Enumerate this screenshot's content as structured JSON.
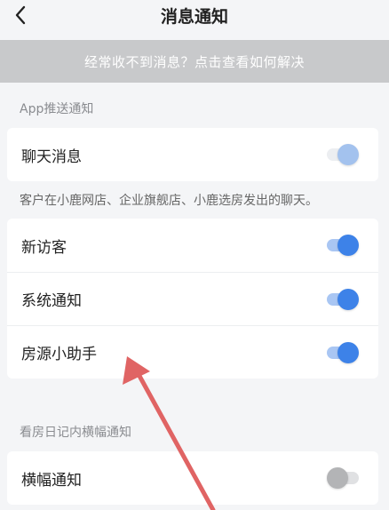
{
  "header": {
    "title": "消息通知",
    "back_icon": "chevron-left-icon"
  },
  "banner": {
    "text": "经常收不到消息？点击查看如何解决"
  },
  "sections": {
    "app_push_label": "App推送通知",
    "chat_note": "客户在小鹿网店、企业旗舰店、小鹿选房发出的聊天。",
    "banner_notice_label": "看房日记内横幅通知"
  },
  "rows": {
    "chat": {
      "label": "聊天消息",
      "enabled": true
    },
    "new_visitor": {
      "label": "新访客",
      "enabled": true
    },
    "system": {
      "label": "系统通知",
      "enabled": true
    },
    "listing_helper": {
      "label": "房源小助手",
      "enabled": true
    },
    "banner_notice": {
      "label": "横幅通知",
      "enabled": false
    }
  },
  "colors": {
    "toggle_on": "#3d82e8",
    "toggle_on_pale": "#a3c2ee",
    "toggle_off": "#b3b4b6",
    "annotation_arrow": "#e06464"
  }
}
